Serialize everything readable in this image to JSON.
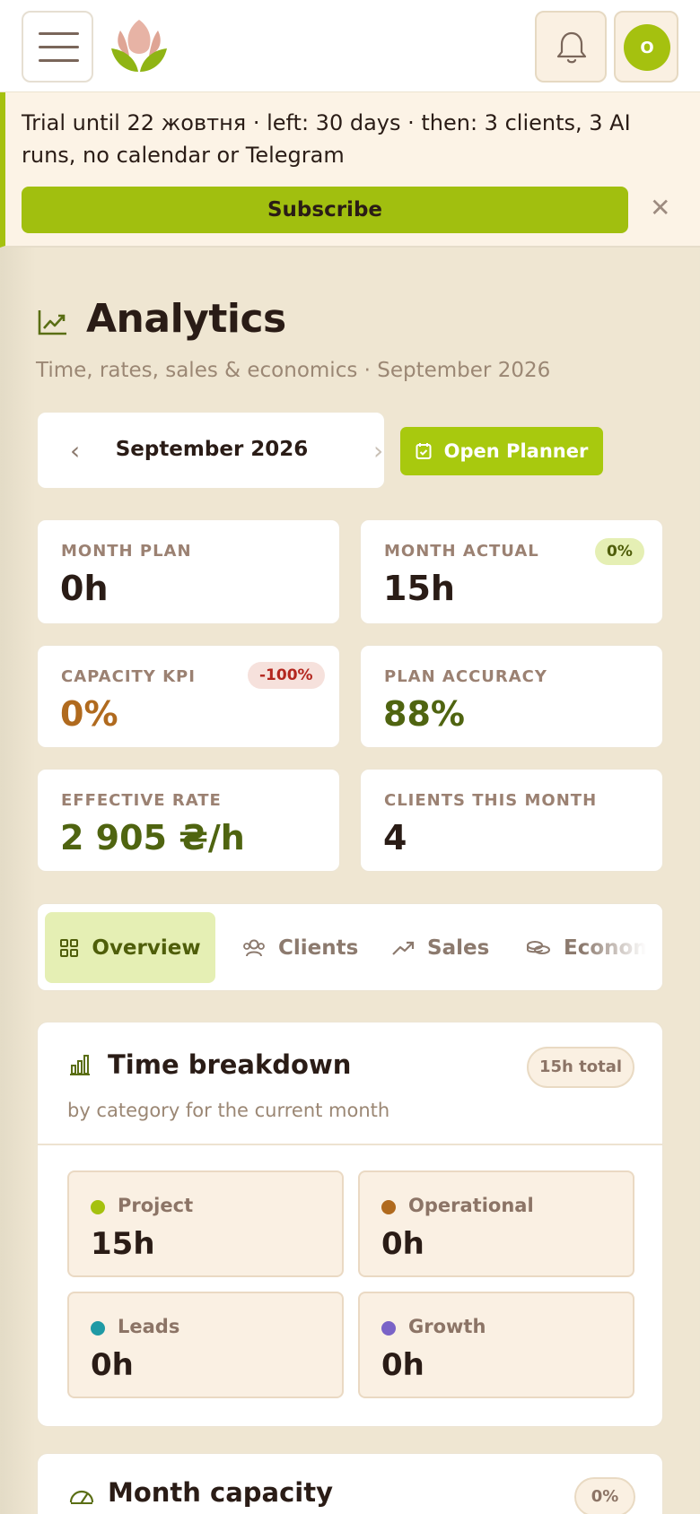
{
  "header": {
    "avatar_initial": "O"
  },
  "trial": {
    "text": "Trial until 22 жовтня · left: 30 days · then: 3 clients, 3 AI runs, no calendar or Telegram",
    "subscribe_label": "Subscribe",
    "close_label": "✕"
  },
  "page": {
    "title": "Analytics",
    "subtitle": "Time, rates, sales & economics · September 2026"
  },
  "month_picker": {
    "label": "September 2026",
    "prev": "‹",
    "next": "›"
  },
  "planner": {
    "label": "Open Planner"
  },
  "kpis": {
    "month_plan": {
      "label": "MONTH PLAN",
      "value": "0h"
    },
    "month_actual": {
      "label": "MONTH ACTUAL",
      "value": "15h",
      "badge": "0%"
    },
    "capacity_kpi": {
      "label": "CAPACITY KPI",
      "value": "0%",
      "badge": "-100%"
    },
    "plan_accuracy": {
      "label": "PLAN ACCURACY",
      "value": "88%"
    },
    "effective_rate": {
      "label": "EFFECTIVE RATE",
      "value": "2 905 ₴/h"
    },
    "clients_month": {
      "label": "CLIENTS THIS MONTH",
      "value": "4"
    }
  },
  "tabs": [
    {
      "label": "Overview",
      "icon": "grid-icon",
      "active": true
    },
    {
      "label": "Clients",
      "icon": "users-icon"
    },
    {
      "label": "Sales",
      "icon": "trend-icon"
    },
    {
      "label": "Economics",
      "icon": "coins-icon"
    }
  ],
  "time_breakdown": {
    "title": "Time breakdown",
    "subtitle": "by category for the current month",
    "total": "15h total",
    "categories": [
      {
        "name": "Project",
        "value": "15h",
        "color": "#a5c10f"
      },
      {
        "name": "Operational",
        "value": "0h",
        "color": "#b06a1e"
      },
      {
        "name": "Leads",
        "value": "0h",
        "color": "#1f9aa5"
      },
      {
        "name": "Growth",
        "value": "0h",
        "color": "#7a63c7"
      }
    ]
  },
  "month_capacity": {
    "title": "Month capacity",
    "badge": "0%"
  },
  "colors": {
    "accent": "#a5c10f",
    "background": "#efe6d2",
    "negative_badge_bg": "#f6e1dc",
    "negative_badge_text": "#b3261e",
    "positive_text": "#4f6410",
    "warning_text": "#b06a1e"
  }
}
